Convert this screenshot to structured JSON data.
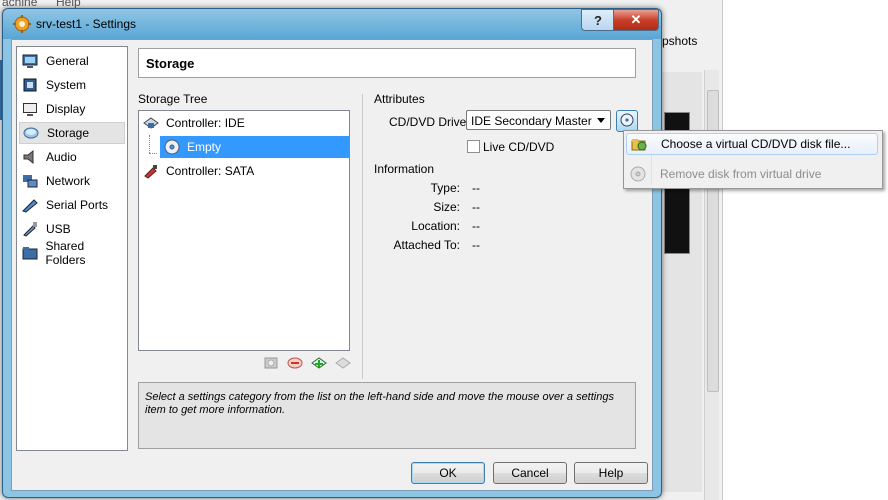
{
  "background": {
    "menubar_items": [
      "achine",
      "Help"
    ],
    "snapshots_label": "pshots"
  },
  "dialog": {
    "title": "srv-test1 - Settings",
    "help_glyph": "?",
    "close_glyph": "✕"
  },
  "categories": [
    {
      "label": "General",
      "icon": "general-icon"
    },
    {
      "label": "System",
      "icon": "system-icon"
    },
    {
      "label": "Display",
      "icon": "display-icon"
    },
    {
      "label": "Storage",
      "icon": "storage-icon",
      "selected": true
    },
    {
      "label": "Audio",
      "icon": "audio-icon"
    },
    {
      "label": "Network",
      "icon": "network-icon"
    },
    {
      "label": "Serial Ports",
      "icon": "serial-ports-icon"
    },
    {
      "label": "USB",
      "icon": "usb-icon"
    },
    {
      "label": "Shared Folders",
      "icon": "shared-folders-icon"
    }
  ],
  "page": {
    "title": "Storage"
  },
  "storage_tree": {
    "label": "Storage Tree",
    "items": [
      {
        "label": "Controller: IDE",
        "icon": "ide-controller-icon"
      },
      {
        "label": "Empty",
        "icon": "cd-icon",
        "selected": true
      },
      {
        "label": "Controller: SATA",
        "icon": "sata-controller-icon"
      }
    ]
  },
  "attributes": {
    "label": "Attributes",
    "cd_drive_label": "CD/DVD Drive:",
    "cd_drive_value": "IDE Secondary Master",
    "live_cd_label": "Live CD/DVD",
    "live_cd_checked": false
  },
  "information": {
    "label": "Information",
    "rows": [
      {
        "key": "Type:",
        "value": "--"
      },
      {
        "key": "Size:",
        "value": "--"
      },
      {
        "key": "Location:",
        "value": "--"
      },
      {
        "key": "Attached To:",
        "value": "--"
      }
    ]
  },
  "hint": "Select a settings category from the list on the left-hand side and move the mouse over a settings item to get more information.",
  "buttons": {
    "ok": "OK",
    "cancel": "Cancel",
    "help": "Help"
  },
  "context_menu": {
    "items": [
      {
        "label": "Choose a virtual CD/DVD disk file...",
        "icon": "folder-cd-icon",
        "highlighted": true
      },
      {
        "label": "Remove disk from virtual drive",
        "icon": "remove-disk-icon",
        "disabled": true
      }
    ]
  },
  "colors": {
    "selection": "#3399ff",
    "title_gradient": "#5aa6d4",
    "close_button": "#c8402a"
  }
}
